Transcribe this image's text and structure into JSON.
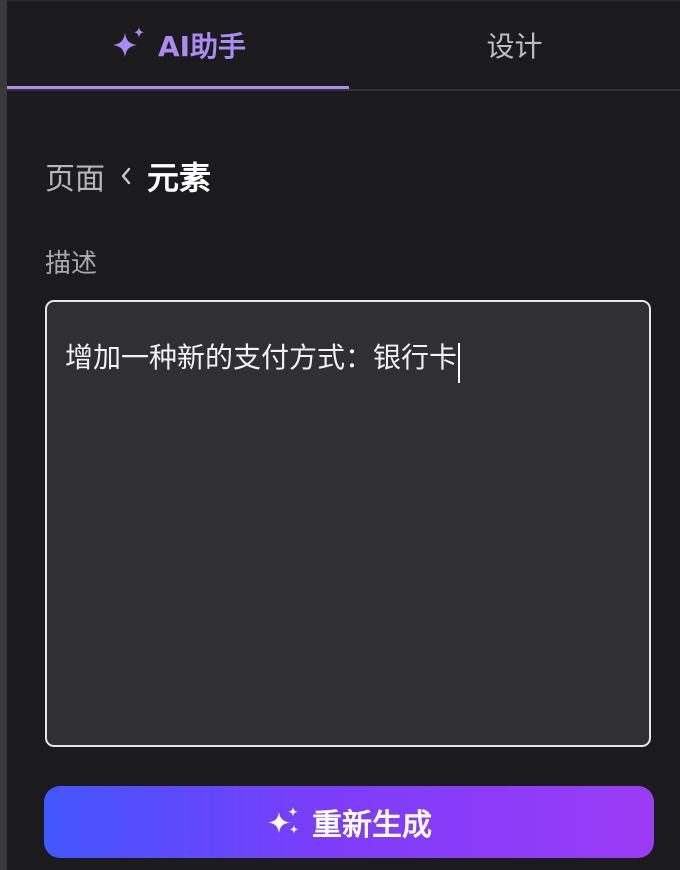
{
  "tabs": {
    "ai": {
      "label": "AI助手",
      "icon": "sparkle-icon",
      "active": true
    },
    "design": {
      "label": "设计",
      "active": false
    }
  },
  "breadcrumb": {
    "parent": "页面",
    "separator_icon": "chevron-left-icon",
    "current": "元素"
  },
  "description": {
    "label": "描述",
    "value": "增加一种新的支付方式：银行卡"
  },
  "actions": {
    "regenerate_label": "重新生成",
    "regenerate_icon": "sparkles-icon"
  },
  "colors": {
    "accent": "#a98bf2",
    "background": "#1b1b1d",
    "input_background": "#303033",
    "button_gradient_start": "#4257ff",
    "button_gradient_end": "#9b3cf6"
  }
}
